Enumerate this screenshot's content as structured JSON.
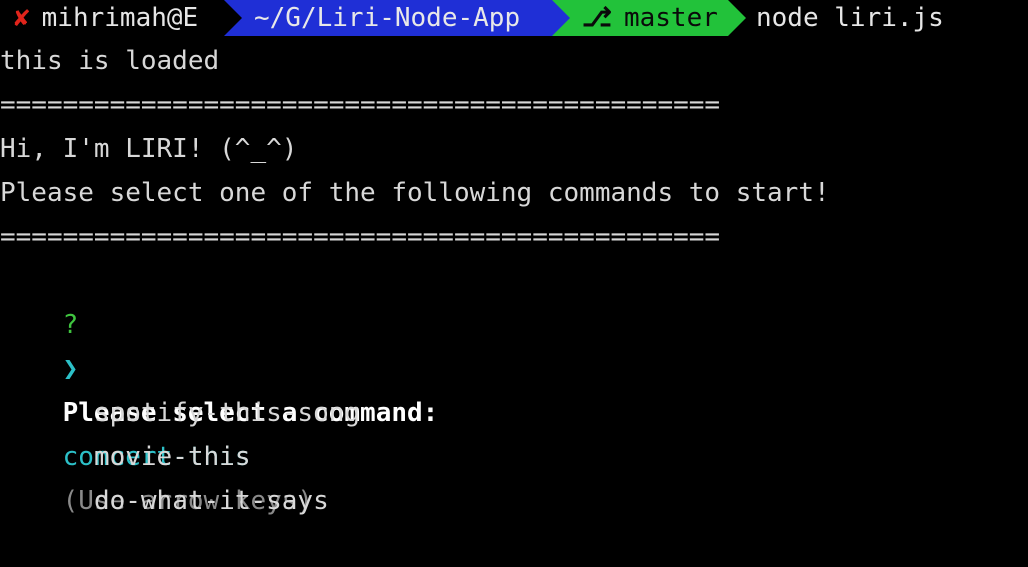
{
  "prompt": {
    "status_glyph": "✘",
    "user_host": "mihrimah@E",
    "directory": "~/G/Liri-Node-App",
    "branch_glyph": "⎇",
    "branch": "master",
    "command": "node liri.js"
  },
  "output": {
    "loaded": "this is loaded",
    "separator_top": "==============================================",
    "greeting": "Hi, I'm LIRI! (^_^)",
    "instruction": "Please select one of the following commands to start!",
    "separator_bottom": "=============================================="
  },
  "question": {
    "marker": "?",
    "label": "Please select a command:",
    "hint": "(Use arrow keys)"
  },
  "menu": {
    "pointer": "❯",
    "options": [
      "concert-this",
      "spotify-this-song",
      "movie-this",
      "do-what-it-says"
    ],
    "selected_index": 0
  },
  "colors": {
    "background": "#000000",
    "dir_segment": "#1f2fd6",
    "git_segment": "#22c23a",
    "error_x": "#e0241b",
    "question_mark": "#3fc43f",
    "selected_option": "#2cc0c8",
    "hint": "#8a8a8a"
  }
}
